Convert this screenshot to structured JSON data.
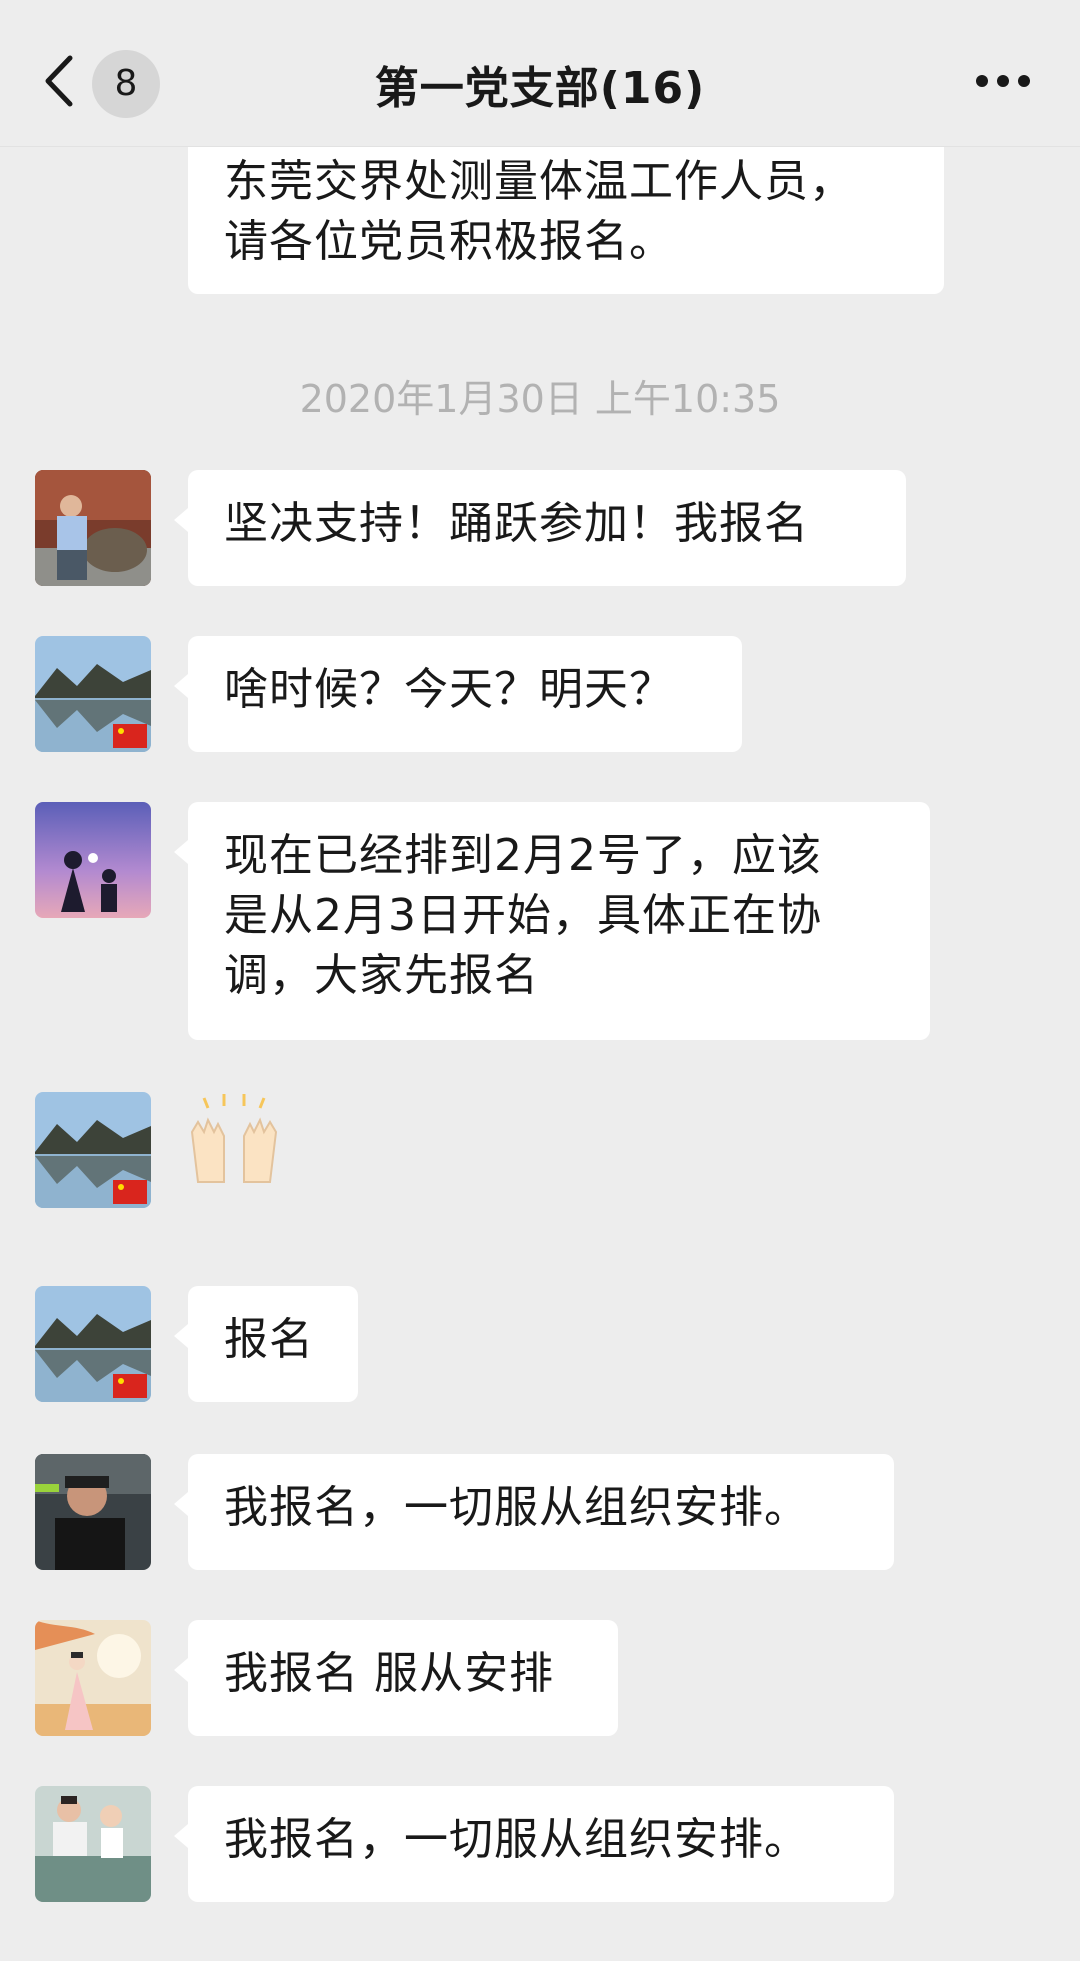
{
  "header": {
    "back_label": "<",
    "badge": "8",
    "title": "第一党支部(16)",
    "more_label": "···"
  },
  "chat": {
    "first_message": "东莞交界处测量体温工作人员，\n请各位党员积极报名。",
    "timestamp": "2020年1月30日 上午10:35",
    "messages": [
      {
        "avatar": "man-with-statue-avatar",
        "text": "坚决支持！踊跃参加！我报名"
      },
      {
        "avatar": "lake-mountain-flag-avatar",
        "text": "啥时候？今天？明天？"
      },
      {
        "avatar": "silhouette-purple-sky-avatar",
        "text": "现在已经排到2月2号了，应该\n是从2月3日开始，具体正在协\n调，大家先报名"
      },
      {
        "avatar": "lake-mountain-flag-avatar",
        "emoji": "raising-hands-emoji"
      },
      {
        "avatar": "lake-mountain-flag-avatar",
        "text": "报名"
      },
      {
        "avatar": "man-black-shirt-avatar",
        "text": "我报名，一切服从组织安排。"
      },
      {
        "avatar": "painted-lady-autumn-avatar",
        "text": "我报名 服从安排"
      },
      {
        "avatar": "woman-with-child-avatar",
        "text": "我报名，一切服从组织安排。"
      }
    ]
  },
  "colors": {
    "background": "#ededed",
    "bubble": "#ffffff",
    "timestamp": "#b2b2b2"
  }
}
